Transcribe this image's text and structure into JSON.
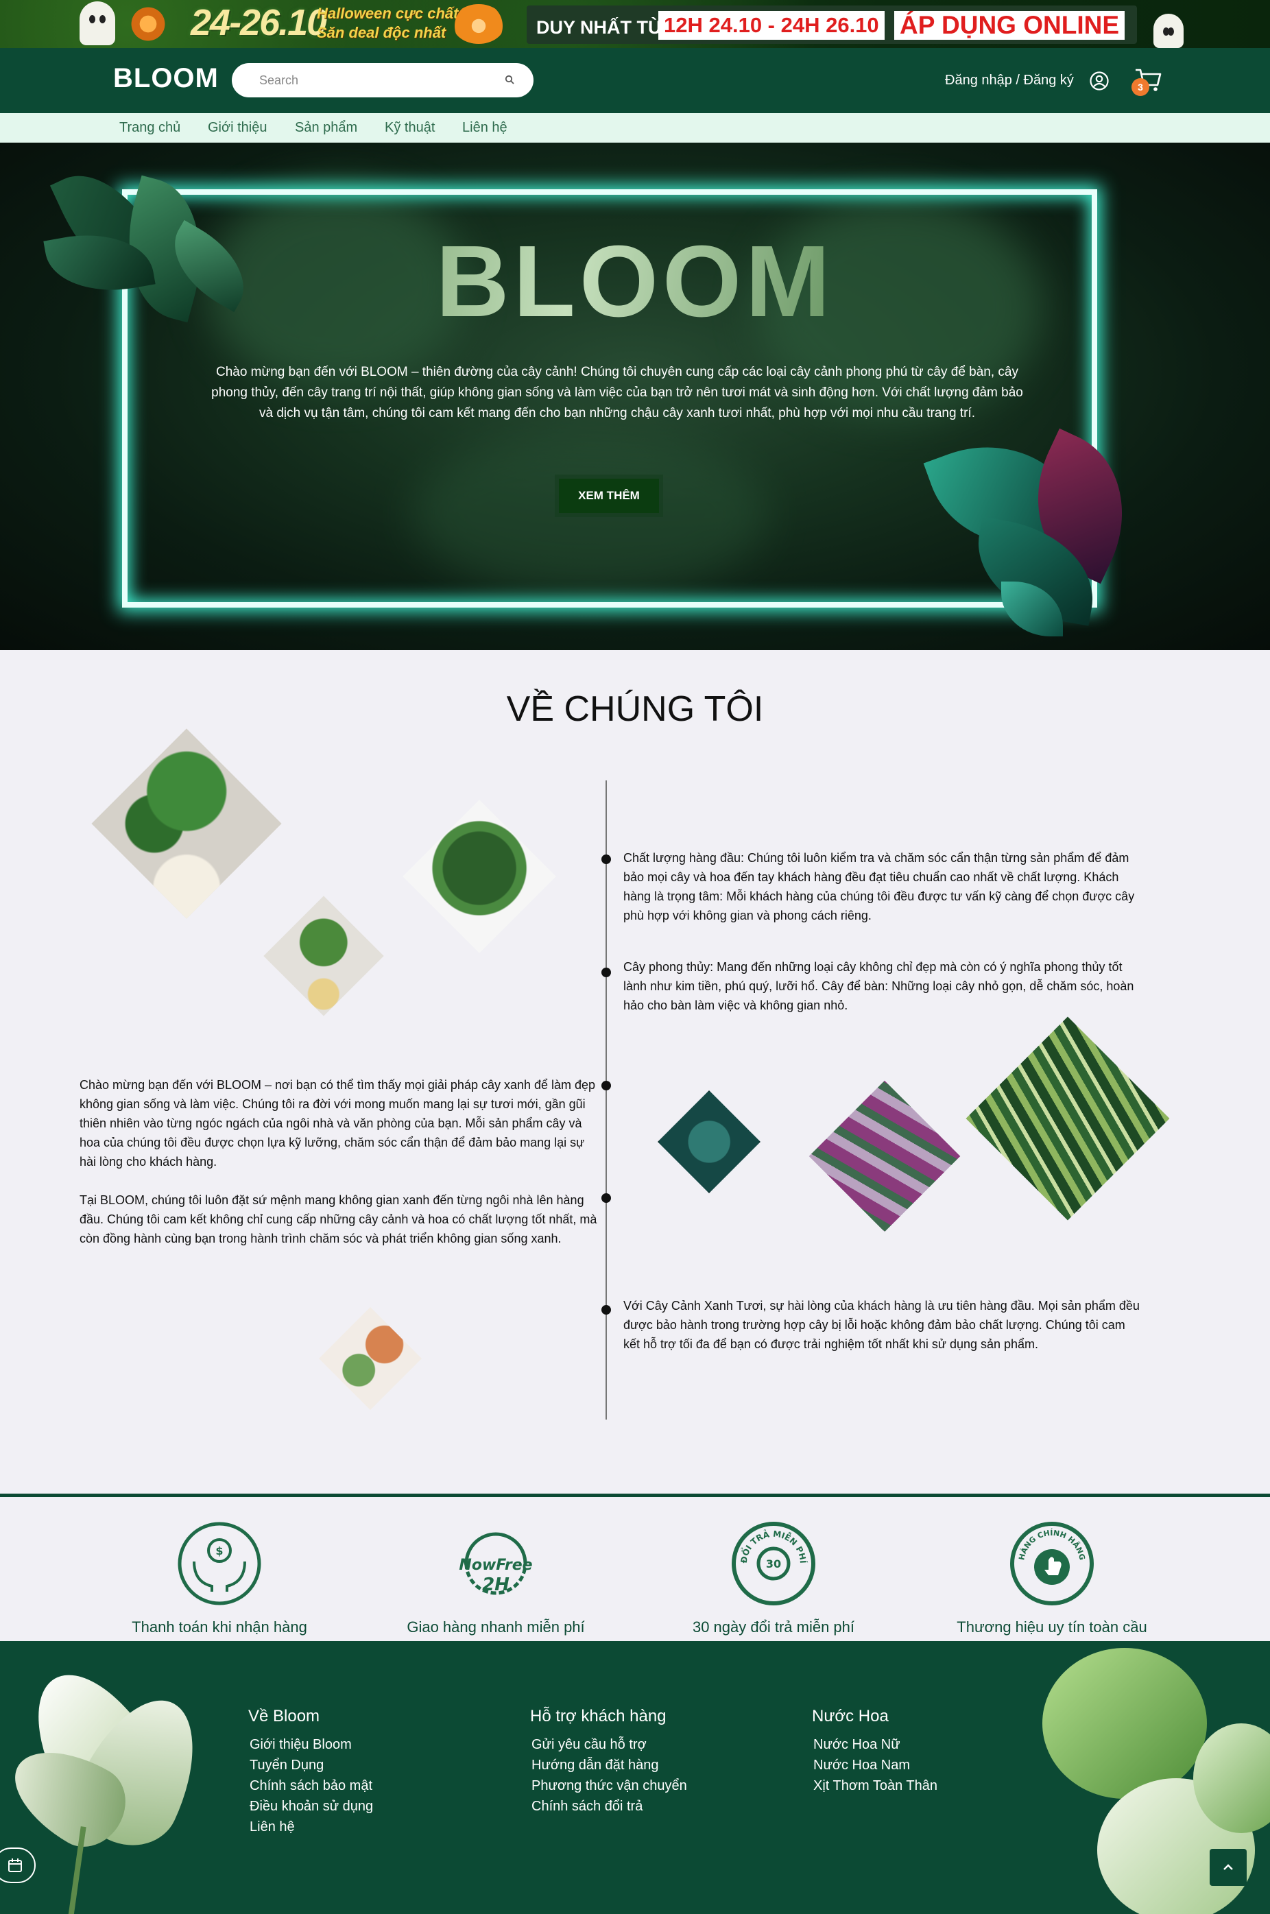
{
  "promo": {
    "dates": "24-26.10",
    "halloween_line1": "Halloween cực chất",
    "halloween_line2": "Săn deal độc nhất",
    "offer_label": "DUY NHẤT TỪ",
    "offer_time": "12H 24.10 - 24H 26.10",
    "offer_cta": "ÁP DỤNG ONLINE"
  },
  "header": {
    "logo": "BLOOM",
    "search_placeholder": "Search",
    "login_label": "Đăng nhập / Đăng ký",
    "cart_count": "3",
    "icons": [
      "search-icon",
      "user-icon",
      "cart-icon"
    ]
  },
  "nav": {
    "items": [
      "Trang chủ",
      "Giới thiệu",
      "Sản phẩm",
      "Kỹ thuật",
      "Liên hệ"
    ]
  },
  "hero": {
    "title": "BLOOM",
    "description": "Chào mừng bạn đến với BLOOM – thiên đường của cây cảnh! Chúng tôi chuyên cung cấp các loại cây cảnh phong phú từ cây để bàn, cây phong thủy, đến cây trang trí nội thất, giúp không gian sống và làm việc của bạn trở nên tươi mát và sinh động hơn. Với chất lượng đảm bảo và dịch vụ tận tâm, chúng tôi cam kết mang đến cho bạn những chậu cây xanh tươi nhất, phù hợp với mọi nhu cầu trang trí.",
    "button": "XEM THÊM"
  },
  "about": {
    "title": "VỀ CHÚNG TÔI",
    "right_1": "Chất lượng hàng đầu: Chúng tôi luôn kiểm tra và chăm sóc cẩn thận từng sản phẩm để đảm bảo mọi cây và hoa đến tay khách hàng đều đạt tiêu chuẩn cao nhất về chất lượng. Khách hàng là trọng tâm: Mỗi khách hàng của chúng tôi đều được tư vấn kỹ càng để chọn được cây phù hợp với không gian và phong cách riêng.",
    "right_2": "Cây phong thủy: Mang đến những loại cây không chỉ đẹp mà còn có ý nghĩa phong thủy tốt lành như kim tiền, phú quý, lưỡi hổ. Cây để bàn: Những loại cây nhỏ gọn, dễ chăm sóc, hoàn hảo cho bàn làm việc và không gian nhỏ.",
    "left_1": "Chào mừng bạn đến với BLOOM – nơi bạn có thể tìm thấy mọi giải pháp cây xanh để làm đẹp không gian sống và làm việc. Chúng tôi ra đời với mong muốn mang lại sự tươi mới, gần gũi thiên nhiên vào từng ngóc ngách của ngôi nhà và văn phòng của bạn. Mỗi sản phẩm cây và hoa của chúng tôi đều được chọn lựa kỹ lưỡng, chăm sóc cẩn thận để đảm bảo mang lại sự hài lòng cho khách hàng.",
    "left_2": "Tại BLOOM, chúng tôi luôn đặt sứ mệnh mang không gian xanh đến từng ngôi nhà lên hàng đầu. Chúng tôi cam kết không chỉ cung cấp những cây cảnh và hoa có chất lượng tốt nhất, mà còn đồng hành cùng bạn trong hành trình chăm sóc và phát triển không gian sống xanh.",
    "right_3": "Với Cây Cảnh Xanh Tươi, sự hài lòng của khách hàng là ưu tiên hàng đầu. Mọi sản phẩm đều được bảo hành trong trường hợp cây bị lỗi hoặc không đảm bảo chất lượng. Chúng tôi cam kết hỗ trợ tối đa để bạn có được trải nghiệm tốt nhất khi sử dụng sản phẩm."
  },
  "features": {
    "items": [
      {
        "label": "Thanh toán khi nhận hàng",
        "icon": "cash-hands-icon"
      },
      {
        "label": "Giao hàng nhanh miễn phí",
        "icon": "nowfree-2h-icon",
        "logo_text_1": "NowFree",
        "logo_text_2": "2H"
      },
      {
        "label": "30 ngày đổi trả miễn phí",
        "icon": "return-30-icon",
        "badge_text": "ĐỔI TRẢ MIỄN PHÍ",
        "badge_number": "30"
      },
      {
        "label": "Thương hiệu uy tín toàn cầu",
        "icon": "genuine-badge-icon",
        "badge_text": "HÀNG CHÍNH HÃNG"
      }
    ]
  },
  "footer": {
    "columns": [
      {
        "title": "Về Bloom",
        "links": [
          "Giới thiệu Bloom",
          "Tuyển Dụng",
          "Chính sách bảo mật",
          "Điều khoản sử dụng",
          "Liên hệ"
        ]
      },
      {
        "title": "Hỗ trợ khách hàng",
        "links": [
          "Gửi yêu cầu hỗ trợ",
          "Hướng dẫn đặt hàng",
          "Phương thức vận chuyển",
          "Chính sách đổi trả"
        ]
      },
      {
        "title": "Nước Hoa",
        "links": [
          "Nước Hoa Nữ",
          "Nước Hoa Nam",
          "Xịt Thơm Toàn Thân"
        ]
      }
    ]
  },
  "colors": {
    "brand_green": "#0c4a34",
    "nav_bg": "#e3f7ed",
    "cart_badge": "#f07a2e",
    "neon_frame": "#3ee6c9",
    "offer_red": "#e01e1e"
  }
}
